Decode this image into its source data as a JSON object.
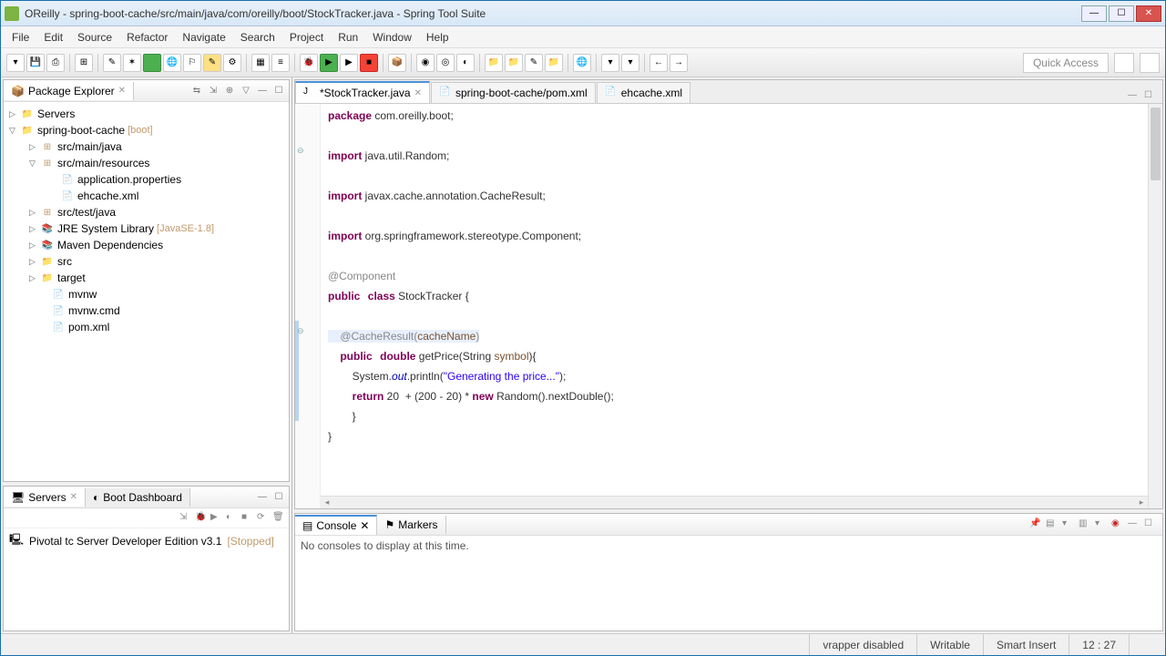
{
  "window": {
    "title": "OReilly - spring-boot-cache/src/main/java/com/oreilly/boot/StockTracker.java - Spring Tool Suite"
  },
  "menu": [
    "File",
    "Edit",
    "Source",
    "Refactor",
    "Navigate",
    "Search",
    "Project",
    "Run",
    "Window",
    "Help"
  ],
  "quick_access": "Quick Access",
  "package_explorer": {
    "title": "Package Explorer",
    "tree": {
      "servers": "Servers",
      "project": "spring-boot-cache",
      "project_decor": "[boot]",
      "src_main_java": "src/main/java",
      "src_main_resources": "src/main/resources",
      "application_properties": "application.properties",
      "ehcache_xml": "ehcache.xml",
      "src_test_java": "src/test/java",
      "jre": "JRE System Library",
      "jre_decor": "[JavaSE-1.8]",
      "maven_deps": "Maven Dependencies",
      "src": "src",
      "target": "target",
      "mvnw": "mvnw",
      "mvnw_cmd": "mvnw.cmd",
      "pom": "pom.xml"
    }
  },
  "editor": {
    "tabs": [
      {
        "label": "*StockTracker.java",
        "active": true
      },
      {
        "label": "spring-boot-cache/pom.xml",
        "active": false
      },
      {
        "label": "ehcache.xml",
        "active": false
      }
    ],
    "code": {
      "l1_kw": "package",
      "l1_rest": " com.oreilly.boot;",
      "l3_kw": "import",
      "l3_rest": " java.util.Random;",
      "l5_kw": "import",
      "l5_rest": " javax.cache.annotation.CacheResult;",
      "l7_kw": "import",
      "l7_rest": " org.springframework.stereotype.Component;",
      "l9": "@Component",
      "l10_kw1": "public",
      "l10_kw2": "class",
      "l10_name": " StockTracker {",
      "l12_pre": "    @CacheResult(",
      "l12_par": "cacheName",
      "l12_post": ")",
      "l13_pre": "    ",
      "l13_kw1": "public",
      "l13_kw2": "double",
      "l13_name": " getPrice(String ",
      "l13_par": "symbol",
      "l13_post": "){",
      "l14_pre": "        System.",
      "l14_fld": "out",
      "l14_mid": ".println(",
      "l14_str": "\"Generating the price...\"",
      "l14_post": ");",
      "l15_pre": "        ",
      "l15_kw1": "return",
      "l15_mid": " 20  + (200 - 20) * ",
      "l15_kw2": "new",
      "l15_post": " Random().nextDouble();",
      "l16": "        }",
      "l17": "}"
    }
  },
  "servers_view": {
    "tab1": "Servers",
    "tab2": "Boot Dashboard",
    "row_name": "Pivotal tc Server Developer Edition v3.1",
    "row_status": "[Stopped]"
  },
  "console_view": {
    "tab1": "Console",
    "tab2": "Markers",
    "message": "No consoles to display at this time."
  },
  "statusbar": {
    "vrapper": "vrapper disabled",
    "writable": "Writable",
    "insert": "Smart Insert",
    "pos": "12 : 27"
  }
}
